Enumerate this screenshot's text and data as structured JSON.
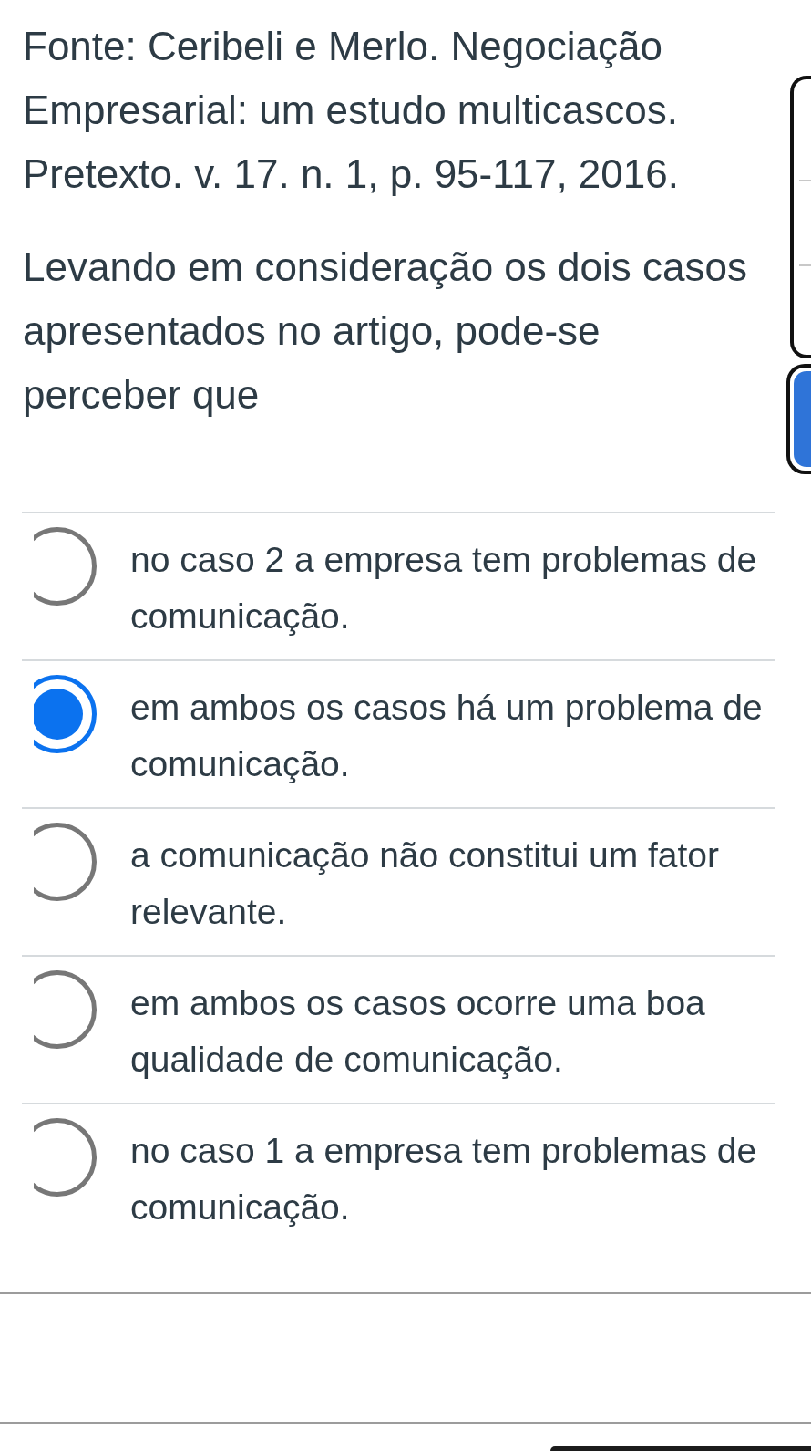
{
  "question": {
    "paragraphs": [
      "Fonte: Ceribeli e Merlo. Negociação Empresarial: um estudo multicascos. Pretexto. v. 17. n. 1, p. 95-117, 2016.",
      "Levando em consideração os dois casos apresentados no artigo, pode-se perceber que"
    ]
  },
  "options": [
    {
      "text": "no caso 2 a empresa tem problemas de comunicação.",
      "selected": false
    },
    {
      "text": "em ambos os casos há um problema de comunicação.",
      "selected": true
    },
    {
      "text": "a comunicação não constitui um fator relevante.",
      "selected": false
    },
    {
      "text": "em ambos os casos ocorre uma boa qualidade de comunicação.",
      "selected": false
    },
    {
      "text": "no caso 1 a empresa tem problemas de comunicação.",
      "selected": false
    }
  ]
}
